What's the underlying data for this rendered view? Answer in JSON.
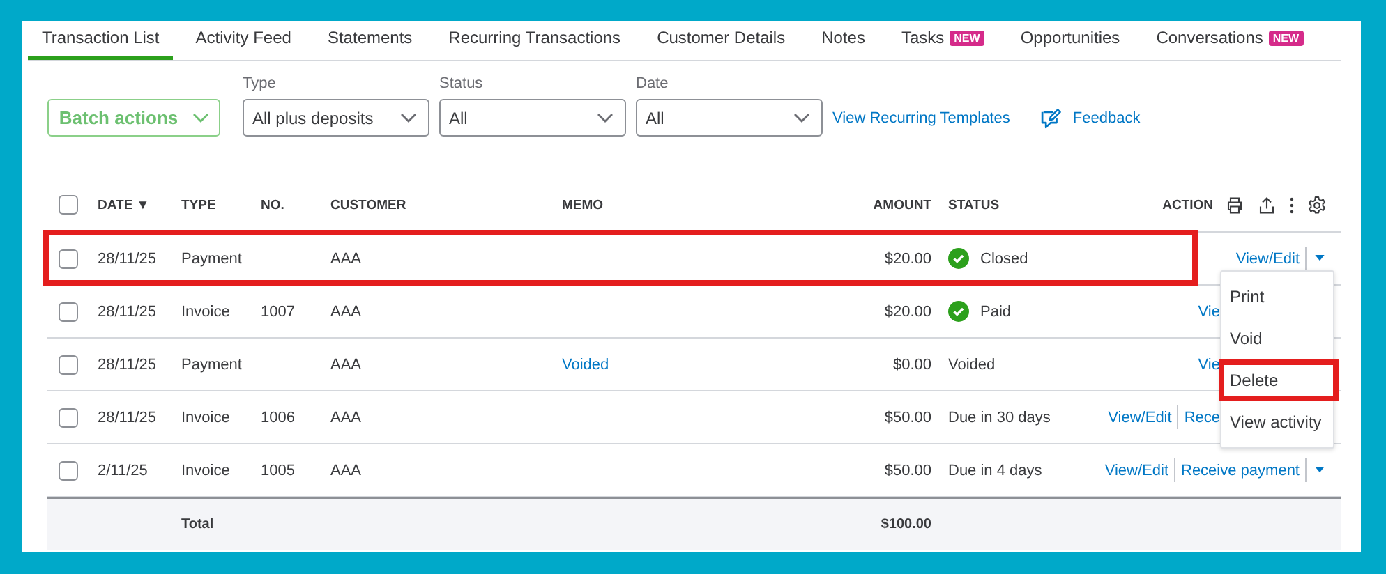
{
  "tabs": [
    {
      "label": "Transaction List",
      "selected": true
    },
    {
      "label": "Activity Feed",
      "selected": false
    },
    {
      "label": "Statements",
      "selected": false
    },
    {
      "label": "Recurring Transactions",
      "selected": false
    },
    {
      "label": "Customer Details",
      "selected": false
    },
    {
      "label": "Notes",
      "selected": false
    },
    {
      "label": "Tasks",
      "selected": false,
      "badge": "NEW"
    },
    {
      "label": "Opportunities",
      "selected": false
    },
    {
      "label": "Conversations",
      "selected": false,
      "badge": "NEW"
    }
  ],
  "toolbar": {
    "batch_button": "Batch actions",
    "filters": [
      {
        "label": "Type",
        "value": "All plus deposits"
      },
      {
        "label": "Status",
        "value": "All"
      },
      {
        "label": "Date",
        "value": "All"
      }
    ],
    "recurring_link": "View Recurring Templates",
    "feedback_link": "Feedback"
  },
  "table": {
    "select_all_checked": false,
    "columns": [
      "DATE ▼",
      "TYPE",
      "NO.",
      "CUSTOMER",
      "MEMO",
      "AMOUNT",
      "STATUS",
      "ACTION"
    ],
    "rows": [
      {
        "checked": false,
        "highlighted": true,
        "date": "28/11/25",
        "type": "Payment",
        "no": "",
        "customer": "AAA",
        "memo": "",
        "amount": "$20.00",
        "status": "Closed",
        "status_check": true,
        "action": {
          "links": [
            "View/Edit"
          ],
          "caret": true,
          "cut": false
        }
      },
      {
        "checked": false,
        "highlighted": false,
        "date": "28/11/25",
        "type": "Invoice",
        "no": "1007",
        "customer": "AAA",
        "memo": "",
        "amount": "$20.00",
        "status": "Paid",
        "status_check": true,
        "action": {
          "links": [
            "Vie"
          ],
          "caret": false,
          "cut": true
        }
      },
      {
        "checked": false,
        "highlighted": false,
        "date": "28/11/25",
        "type": "Payment",
        "no": "",
        "customer": "AAA",
        "memo": "Voided",
        "amount": "$0.00",
        "status": "Voided",
        "status_check": false,
        "action": {
          "links": [
            "Vie"
          ],
          "caret": false,
          "cut": true
        }
      },
      {
        "checked": false,
        "highlighted": false,
        "date": "28/11/25",
        "type": "Invoice",
        "no": "1006",
        "customer": "AAA",
        "memo": "",
        "amount": "$50.00",
        "status": "Due in 30 days",
        "status_check": false,
        "action": {
          "links": [
            "View/Edit",
            "Rece"
          ],
          "caret": false,
          "cut": true
        }
      },
      {
        "checked": false,
        "highlighted": false,
        "date": "2/11/25",
        "type": "Invoice",
        "no": "1005",
        "customer": "AAA",
        "memo": "",
        "amount": "$50.00",
        "status": "Due in 4 days",
        "status_check": false,
        "action": {
          "links": [
            "View/Edit",
            "Receive payment"
          ],
          "caret": true,
          "cut": false
        }
      }
    ],
    "total": {
      "label": "Total",
      "amount": "$100.00"
    }
  },
  "action_menu": {
    "items": [
      {
        "label": "Print",
        "highlighted": false
      },
      {
        "label": "Void",
        "highlighted": false
      },
      {
        "label": "Delete",
        "highlighted": true
      },
      {
        "label": "View activity",
        "highlighted": false
      }
    ]
  }
}
